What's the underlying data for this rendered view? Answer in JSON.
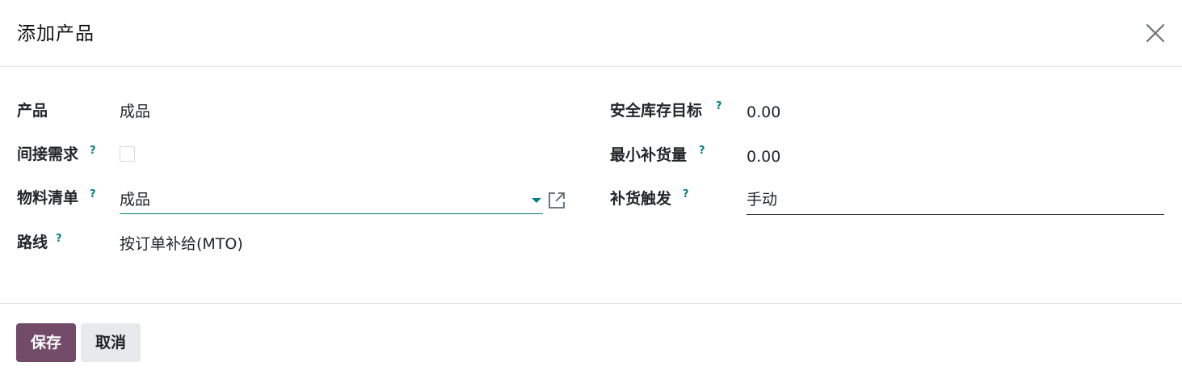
{
  "dialog": {
    "title": "添加产品",
    "close_icon": "close-icon"
  },
  "form": {
    "product": {
      "label": "产品",
      "value": "成品"
    },
    "indirect_demand": {
      "label": "间接需求",
      "help": "?",
      "checked": false
    },
    "bom": {
      "label": "物料清单",
      "help": "?",
      "value": "成品",
      "caret_icon": "caret-down-icon",
      "link_icon": "external-link-icon"
    },
    "route": {
      "label": "路线",
      "help": "?",
      "value": "按订单补给(MTO)"
    },
    "safety_stock_target": {
      "label": "安全库存目标",
      "help": "?",
      "value": "0.00"
    },
    "min_replenish_qty": {
      "label": "最小补货量",
      "help": "?",
      "value": "0.00"
    },
    "replenish_trigger": {
      "label": "补货触发",
      "help": "?",
      "value": "手动"
    }
  },
  "footer": {
    "save_label": "保存",
    "cancel_label": "取消"
  },
  "colors": {
    "primary": "#714b67",
    "accent": "#017e84",
    "secondary_button": "#e7e9ed"
  }
}
